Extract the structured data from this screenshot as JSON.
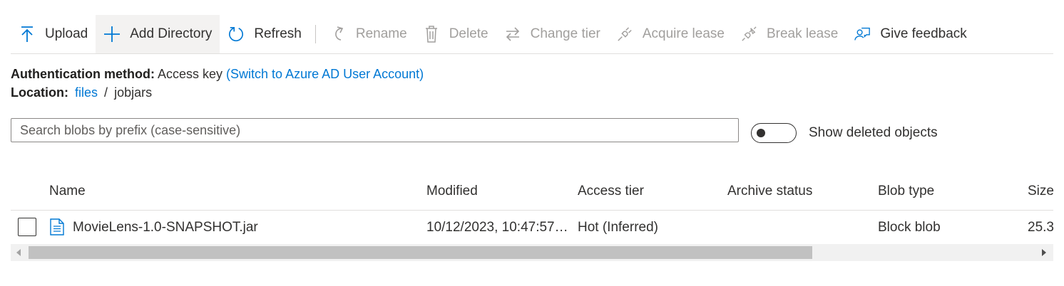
{
  "toolbar": {
    "upload": {
      "label": "Upload",
      "icon": "arrow-up-icon"
    },
    "add_directory": {
      "label": "Add Directory",
      "icon": "plus-icon"
    },
    "refresh": {
      "label": "Refresh",
      "icon": "refresh-icon"
    },
    "rename": {
      "label": "Rename",
      "icon": "rename-icon"
    },
    "delete": {
      "label": "Delete",
      "icon": "trash-icon"
    },
    "change_tier": {
      "label": "Change tier",
      "icon": "swap-icon"
    },
    "acquire_lease": {
      "label": "Acquire lease",
      "icon": "plug-icon"
    },
    "break_lease": {
      "label": "Break lease",
      "icon": "plug-broken-icon"
    },
    "give_feedback": {
      "label": "Give feedback",
      "icon": "feedback-icon"
    }
  },
  "auth": {
    "label": "Authentication method:",
    "value": "Access key",
    "switch_link": "(Switch to Azure AD User Account)"
  },
  "location": {
    "label": "Location:",
    "root_link": "files",
    "separator": "/",
    "current": "jobjars"
  },
  "search": {
    "placeholder": "Search blobs by prefix (case-sensitive)",
    "value": ""
  },
  "show_deleted": {
    "label": "Show deleted objects",
    "enabled": false
  },
  "table": {
    "columns": [
      "Name",
      "Modified",
      "Access tier",
      "Archive status",
      "Blob type",
      "Size"
    ],
    "rows": [
      {
        "name": "MovieLens-1.0-SNAPSHOT.jar",
        "modified": "10/12/2023, 10:47:57…",
        "access_tier": "Hot (Inferred)",
        "archive_status": "",
        "blob_type": "Block blob",
        "size": "25.3"
      }
    ]
  },
  "colors": {
    "accent": "#0078d4",
    "text": "#323130",
    "disabled": "#a19f9d",
    "border": "#e1dfdd"
  }
}
